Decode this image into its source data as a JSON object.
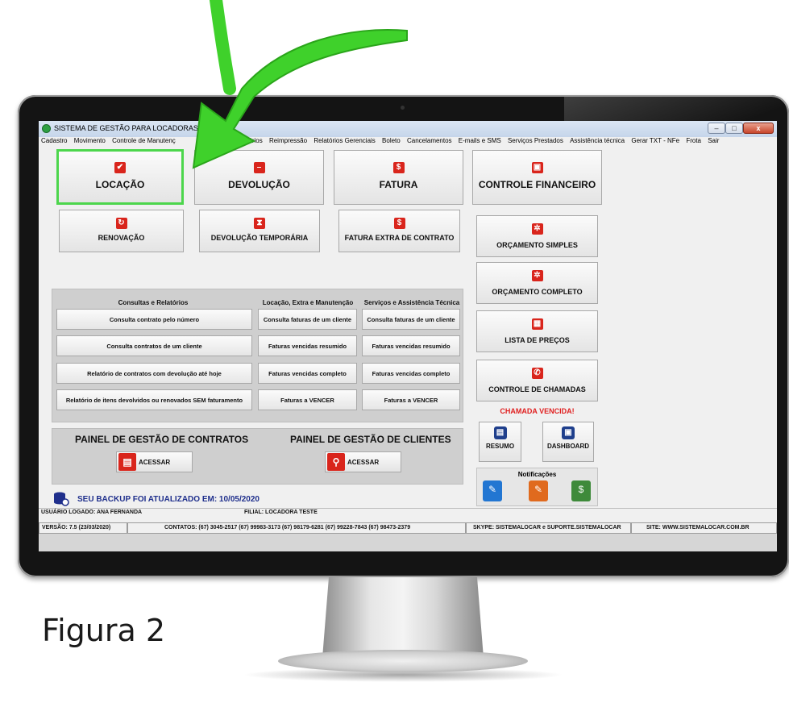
{
  "window": {
    "title": "SISTEMA DE GESTÃO PARA LOCADORAS DE BE",
    "controls": {
      "minimize": "–",
      "maximize": "□",
      "close": "x"
    }
  },
  "menu": [
    "Cadastro",
    "Movimento",
    "Controle de Manutenç",
    "ltas",
    "Relatórios",
    "Reimpressão",
    "Relatórios Gerenciais",
    "Boleto",
    "Cancelamentos",
    "E-mails e SMS",
    "Serviços Prestados",
    "Assistência técnica",
    "Gerar TXT - NFe",
    "Frota",
    "Sair"
  ],
  "tiles": {
    "locacao": "LOCAÇÃO",
    "devolucao": "DEVOLUÇÃO",
    "fatura": "FATURA",
    "controle_financeiro": "CONTROLE FINANCEIRO",
    "renovacao": "RENOVAÇÃO",
    "devolucao_temporaria": "DEVOLUÇÃO TEMPORÁRIA",
    "fatura_extra": "FATURA EXTRA DE CONTRATO",
    "orcamento_simples": "ORÇAMENTO SIMPLES",
    "orcamento_completo": "ORÇAMENTO COMPLETO",
    "lista_precos": "LISTA DE PREÇOS",
    "controle_chamadas": "CONTROLE DE CHAMADAS"
  },
  "chamada_alert": "CHAMADA VENCIDA!",
  "queries": {
    "headers": [
      "Consultas e Relatórios",
      "Locação, Extra e Manutenção",
      "Serviços e Assistência Técnica"
    ],
    "col1": [
      "Consulta contrato pelo número",
      "Consulta contratos de um cliente",
      "Relatório de contratos com devolução até hoje",
      "Relatório de itens devolvidos ou renovados SEM faturamento"
    ],
    "col2": [
      "Consulta faturas de um cliente",
      "Faturas vencidas resumido",
      "Faturas vencidas completo",
      "Faturas a VENCER"
    ],
    "col3": [
      "Consulta faturas de um cliente",
      "Faturas vencidas resumido",
      "Faturas vencidas completo",
      "Faturas a VENCER"
    ]
  },
  "gestao": {
    "contratos_title": "PAINEL DE GESTÃO DE CONTRATOS",
    "clientes_title": "PAINEL DE GESTÃO DE CLIENTES",
    "acessar": "ACESSAR"
  },
  "resumo": "RESUMO",
  "dashboard": "DASHBOARD",
  "notificacoes": "Notificações",
  "backup": "SEU BACKUP FOI ATUALIZADO EM: 10/05/2020",
  "status": {
    "usuario": "USUÁRIO LOGADO: ANA FERNANDA",
    "filial": "FILIAL: LOCADORA TESTE",
    "versao": "VERSÃO: 7.5 (23/03/2020)",
    "contatos": "CONTATOS: (67) 3045-2517  (67) 99983-3173  (67) 98179-6281  (67) 99228-7843  (67) 98473-2379",
    "skype": "SKYPE: SISTEMALOCAR e SUPORTE.SISTEMALOCAR",
    "site": "SITE: WWW.SISTEMALOCAR.COM.BR"
  },
  "caption": "Figura 2",
  "colors": {
    "accent_red": "#d9251c",
    "highlight_green": "#4cd64c",
    "arrow_green": "#3fd12b",
    "backup_text": "#1f2f8c",
    "alert_red": "#e02020"
  }
}
